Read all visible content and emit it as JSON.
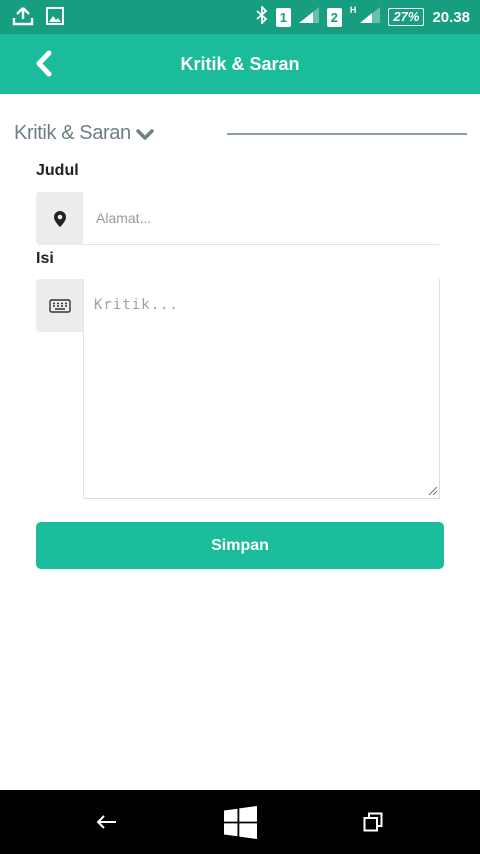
{
  "status_bar": {
    "sim1": "1",
    "sim2": "2",
    "network_type": "H",
    "battery": "27%",
    "time": "20.38",
    "icons": [
      "upload-icon",
      "image-icon",
      "bluetooth-icon",
      "signal-icon",
      "battery-icon"
    ]
  },
  "header": {
    "title": "Kritik & Saran",
    "back_icon": "chevron-left-icon"
  },
  "section": {
    "title": "Kritik & Saran",
    "toggle_icon": "chevron-down-icon"
  },
  "form": {
    "judul_label": "Judul",
    "judul_placeholder": "Alamat...",
    "judul_icon": "map-marker-icon",
    "isi_label": "Isi",
    "isi_placeholder": "Kritik...",
    "isi_icon": "keyboard-icon",
    "submit_label": "Simpan"
  },
  "nav_bar": {
    "items": [
      "back-arrow-icon",
      "windows-home-icon",
      "recent-apps-icon"
    ]
  },
  "colors": {
    "status_bar": "#179e80",
    "primary": "#1abc9c",
    "nav_bar": "#000000"
  }
}
